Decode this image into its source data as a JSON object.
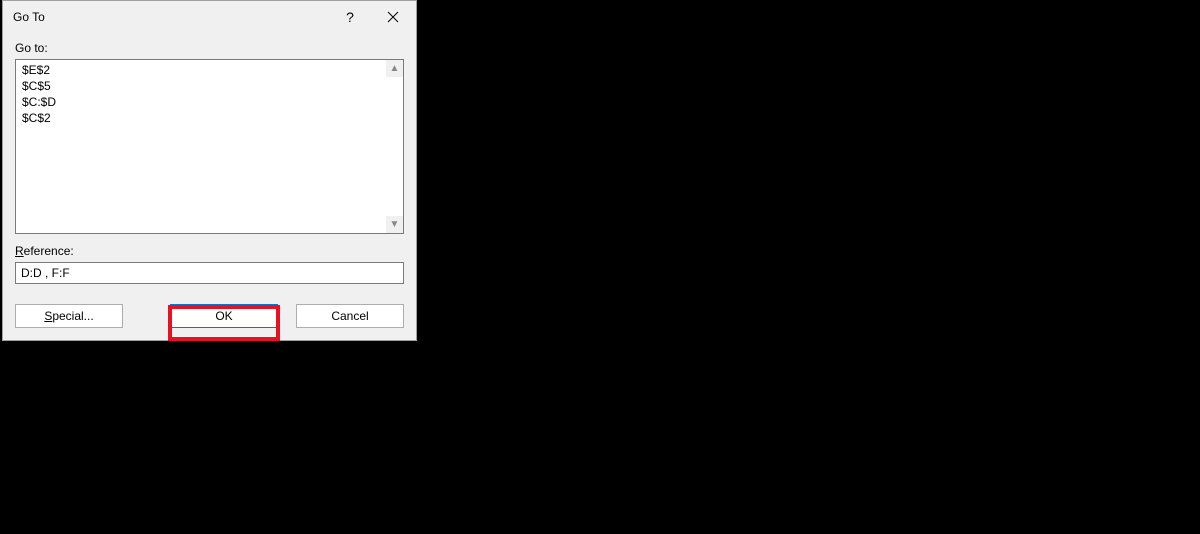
{
  "dialog": {
    "title": "Go To",
    "goto_label": "Go to:",
    "list_items": [
      "$E$2",
      "$C$5",
      "$C:$D",
      "$C$2"
    ],
    "reference_label": "Reference:",
    "reference_value": "D:D , F:F",
    "buttons": {
      "special": "Special...",
      "ok": "OK",
      "cancel": "Cancel"
    }
  }
}
